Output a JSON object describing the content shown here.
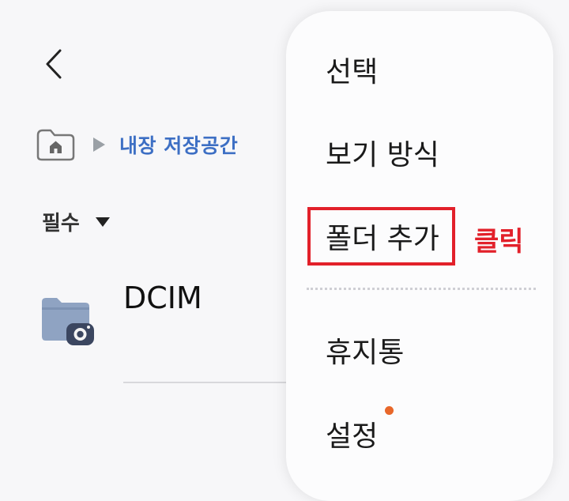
{
  "header": {
    "back_icon": "chevron-left-icon"
  },
  "breadcrumb": {
    "home_icon": "home-folder-icon",
    "separator_icon": "triangle-right-icon",
    "current": "내장 저장공간"
  },
  "section": {
    "label": "필수",
    "caret_icon": "caret-down-icon"
  },
  "folders": [
    {
      "name": "DCIM",
      "icon": "camera-folder-icon"
    }
  ],
  "menu": {
    "items": [
      {
        "label": "선택"
      },
      {
        "label": "보기 방식"
      },
      {
        "label": "폴더 추가"
      },
      {
        "label": "휴지통"
      },
      {
        "label": "설정"
      }
    ]
  },
  "annotation": {
    "label": "클릭",
    "color": "#e2202a"
  },
  "colors": {
    "accent": "#3d6fc4",
    "notification_dot": "#e8672a",
    "highlight": "#e2202a"
  }
}
